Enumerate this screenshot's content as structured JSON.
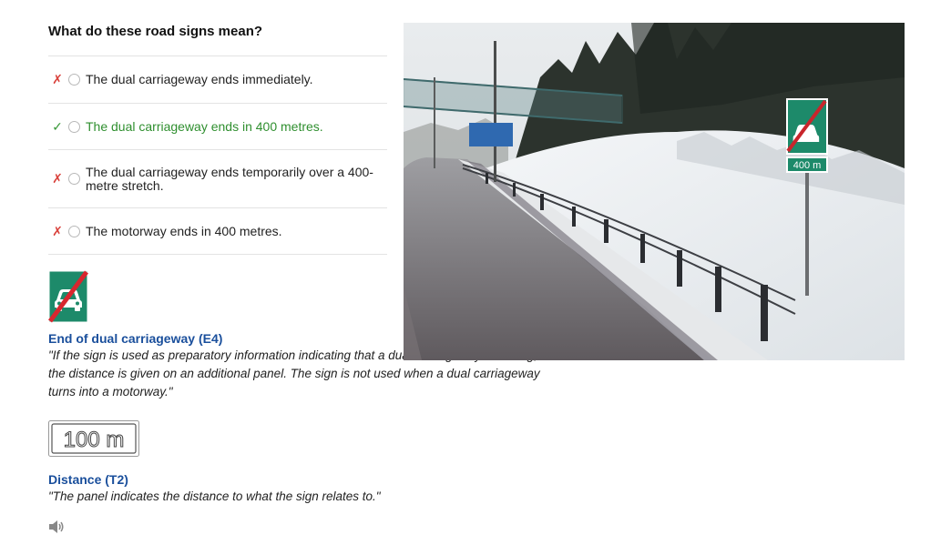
{
  "question": "What do these road signs mean?",
  "options": [
    {
      "mark": "✗",
      "label": "The dual carriageway ends immediately.",
      "correct": false
    },
    {
      "mark": "✓",
      "label": "The dual carriageway ends in 400 metres.",
      "correct": true
    },
    {
      "mark": "✗",
      "label": "The dual carriageway ends temporarily over a 400-metre stretch.",
      "correct": false
    },
    {
      "mark": "✗",
      "label": "The motorway ends in 400 metres.",
      "correct": false
    }
  ],
  "signs": [
    {
      "title": "End of dual carriageway (E4)",
      "quote": "\"If the sign is used as preparatory information indicating that a dual carriageway is ending, the distance is given on an additional panel. The sign is not used when a dual carriageway turns into a motorway.\""
    },
    {
      "title": "Distance (T2)",
      "quote": "\"The panel indicates the distance to what the sign relates to.\"",
      "panel_text": "100 m"
    }
  ],
  "photo": {
    "roadside_panel_text": "400 m"
  },
  "colors": {
    "sign_green": "#1d8a6a",
    "strike_red": "#d8262e",
    "heading_blue": "#1a4f9c",
    "correct_green": "#2f8f2f",
    "wrong_red": "#d9413b"
  },
  "icons": {
    "audio": "speaker-icon"
  }
}
